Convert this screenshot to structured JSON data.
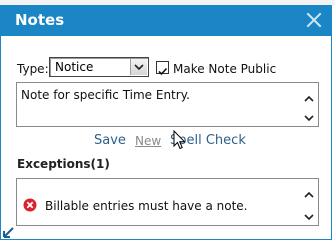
{
  "dialog": {
    "title": "Notes",
    "close_icon": "close-icon"
  },
  "form": {
    "type_label": "Type:",
    "type_value": "Notice",
    "make_public_label": "Make Note Public",
    "make_public_checked": true
  },
  "note": {
    "text": "Note for specific Time Entry."
  },
  "actions": {
    "save": "Save",
    "new": "New",
    "spell_check": "Spell Check"
  },
  "exceptions": {
    "heading": "Exceptions(1)",
    "items": [
      {
        "icon": "error-icon",
        "text": "Billable entries must have a note."
      }
    ]
  },
  "colors": {
    "accent": "#1a86c5",
    "link": "#2f5f86",
    "error": "#d9232e"
  }
}
